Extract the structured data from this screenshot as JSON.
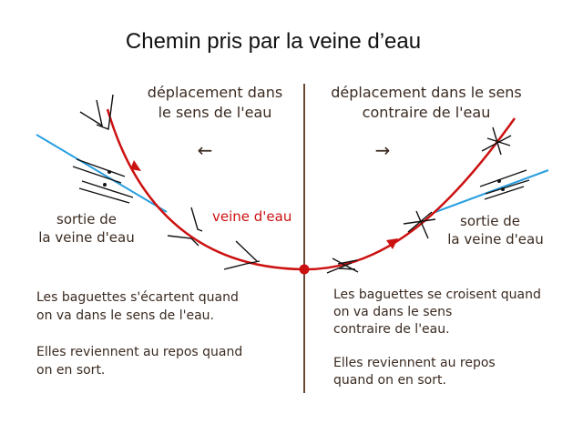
{
  "title": "Chemin pris par la veine d’eau",
  "left": {
    "direction_line1": "déplacement dans",
    "direction_line2": "le sens de l'eau",
    "arrow_glyph": "←",
    "exit_line1": "sortie de",
    "exit_line2": "la veine d'eau",
    "note_line1": "Les baguettes s'écartent quand",
    "note_line2": "on va dans le sens  de l'eau.",
    "note_line3": "Elles reviennent au repos quand",
    "note_line4": "on en sort."
  },
  "right": {
    "direction_line1": "déplacement dans le sens",
    "direction_line2": "contraire  de l'eau",
    "arrow_glyph": "→",
    "exit_line1": "sortie de",
    "exit_line2": "la veine d'eau",
    "note_line1": "Les baguettes se croisent quand",
    "note_line2": "on va  dans le sens",
    "note_line3": "contraire de l'eau.",
    "note_line4": "Elles reviennent au repos",
    "note_line5": "quand on en sort."
  },
  "vein_label": "veine d'eau",
  "colors": {
    "vein": "#cc1111",
    "exit_path": "#2a9fe0",
    "divider": "#6b4a35",
    "text": "#3a2a20",
    "rods": "#111111"
  }
}
